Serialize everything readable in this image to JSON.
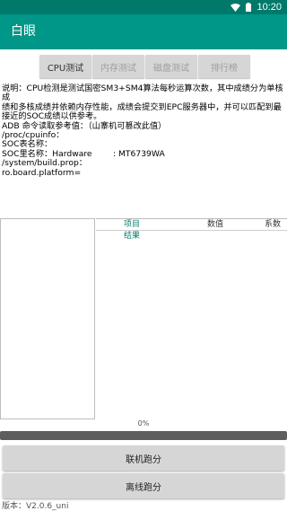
{
  "status_bar": {
    "time": "10:20",
    "icons": [
      "wifi-icon",
      "battery-icon"
    ]
  },
  "app_bar": {
    "title": "白眼"
  },
  "tabs": [
    {
      "label": "CPU测试",
      "active": true
    },
    {
      "label": "内存测试",
      "active": false
    },
    {
      "label": "磁盘测试",
      "active": false
    },
    {
      "label": "排行榜",
      "active": false
    }
  ],
  "info_lines": [
    "说明：CPU检测是测试国密SM3+SM4算法每秒运算次数，其中成绩分为单核成",
    "绩和多核成绩并依赖内存性能，成绩会提交到EPC服务器中，并可以匹配到最",
    "接近的SOC成绩以供参考。",
    "ADB 命令读取参考值：（山寨机可篡改此值）",
    "/proc/cpuinfo：",
    "SOC表名称：",
    "SOC里名称：Hardware        : MT6739WA",
    "/system/build.prop：",
    "ro.board.platform="
  ],
  "table": {
    "headers": {
      "item": "项目",
      "value": "数值",
      "score": "系数"
    },
    "result_label": "结果"
  },
  "progress": {
    "text": "0%",
    "value": 0
  },
  "buttons": {
    "online": "联机跑分",
    "offline": "离线跑分"
  },
  "version": "版本：V2.0.6_uni",
  "colors": {
    "primary": "#009688",
    "primary_dark": "#00796b",
    "button": "#d6d6d6"
  }
}
